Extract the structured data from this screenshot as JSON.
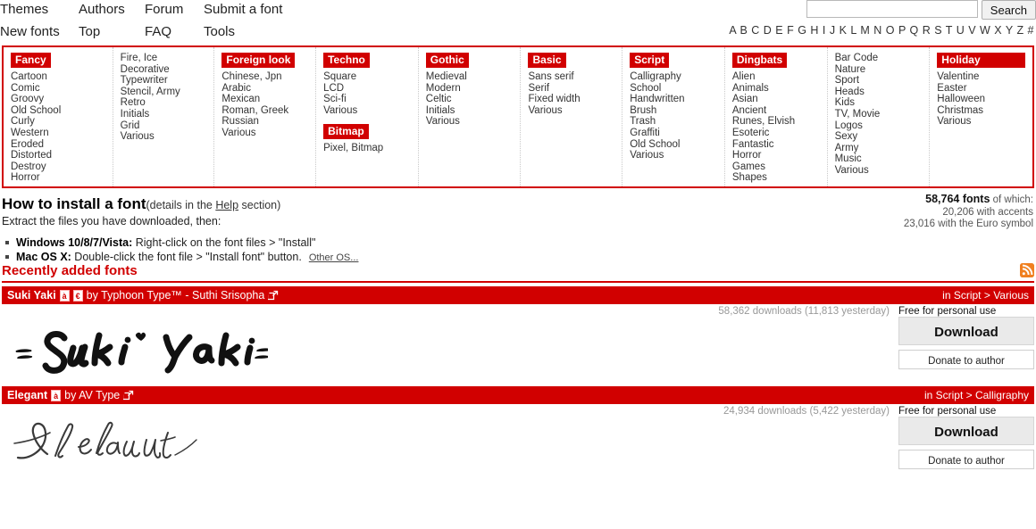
{
  "nav": {
    "row1": [
      "Themes",
      "Authors",
      "Forum",
      "Submit a font"
    ],
    "row2": [
      "New fonts",
      "Top",
      "FAQ",
      "Tools"
    ]
  },
  "search": {
    "value": "",
    "placeholder": "",
    "button_label": "Search"
  },
  "alphabet": "A B C D E F G H I J K L M N O P Q R S T U V W X Y Z #",
  "categories": [
    {
      "heading": "Fancy",
      "items": [
        "Cartoon",
        "Comic",
        "Groovy",
        "Old School",
        "Curly",
        "Western",
        "Eroded",
        "Distorted",
        "Destroy",
        "Horror"
      ]
    },
    {
      "heading": "",
      "items": [
        "Fire, Ice",
        "Decorative",
        "Typewriter",
        "Stencil, Army",
        "Retro",
        "Initials",
        "Grid",
        "Various"
      ]
    },
    {
      "heading": "Foreign look",
      "items": [
        "Chinese, Jpn",
        "Arabic",
        "Mexican",
        "Roman, Greek",
        "Russian",
        "Various"
      ]
    },
    {
      "heading": "Techno",
      "items": [
        "Square",
        "LCD",
        "Sci-fi",
        "Various"
      ],
      "heading2": "Bitmap",
      "items2": [
        "Pixel, Bitmap"
      ]
    },
    {
      "heading": "Gothic",
      "items": [
        "Medieval",
        "Modern",
        "Celtic",
        "Initials",
        "Various"
      ]
    },
    {
      "heading": "Basic",
      "items": [
        "Sans serif",
        "Serif",
        "Fixed width",
        "Various"
      ]
    },
    {
      "heading": "Script",
      "items": [
        "Calligraphy",
        "School",
        "Handwritten",
        "Brush",
        "Trash",
        "Graffiti",
        "Old School",
        "Various"
      ]
    },
    {
      "heading": "Dingbats",
      "items": [
        "Alien",
        "Animals",
        "Asian",
        "Ancient",
        "Runes, Elvish",
        "Esoteric",
        "Fantastic",
        "Horror",
        "Games",
        "Shapes"
      ]
    },
    {
      "heading": "",
      "items": [
        "Bar Code",
        "Nature",
        "Sport",
        "Heads",
        "Kids",
        "TV, Movie",
        "Logos",
        "Sexy",
        "Army",
        "Music",
        "Various"
      ]
    },
    {
      "heading": "Holiday",
      "items": [
        "Valentine",
        "Easter",
        "Halloween",
        "Christmas",
        "Various"
      ]
    }
  ],
  "install": {
    "title": "How to install a font",
    "subtitle_pre": "(details in the ",
    "subtitle_link": "Help",
    "subtitle_post": " section)",
    "extract": "Extract the files you have downloaded, then:",
    "bullets": [
      {
        "bold": "Windows 10/8/7/Vista:",
        "text": " Right-click on the font files > \"Install\""
      },
      {
        "bold": "Mac OS X:",
        "text": " Double-click the font file > \"Install font\" button."
      }
    ],
    "other_os": "Other OS..."
  },
  "stats": {
    "total": "58,764 fonts",
    "total_suffix": " of which:",
    "accents": "20,206 with accents",
    "euro": "23,016 with the Euro symbol"
  },
  "recent": {
    "title": "Recently added fonts",
    "rss_icon": "rss-icon"
  },
  "fonts": [
    {
      "name": "Suki Yaki",
      "badges": [
        "accent-badge",
        "euro-badge"
      ],
      "by": "by Typhoon Type™ - Suthi Srisopha",
      "external_icon": "external-link-icon",
      "category": "in Script > Various",
      "downloads": "58,362 downloads (11,813 yesterday)",
      "license": "Free for personal use",
      "download_label": "Download",
      "donate_label": "Donate to author",
      "preview_text": "Suki Yaki"
    },
    {
      "name": "Elegant",
      "badges": [
        "accent-badge"
      ],
      "by": "by AV Type",
      "external_icon": "external-link-icon",
      "category": "in Script > Calligraphy",
      "downloads": "24,934 downloads (5,422 yesterday)",
      "license": "Free for personal use",
      "download_label": "Download",
      "donate_label": "Donate to author",
      "preview_text": "Elegant"
    }
  ],
  "colors": {
    "brand_red": "#d10000",
    "rss_orange": "#f08020",
    "muted": "#999999"
  }
}
